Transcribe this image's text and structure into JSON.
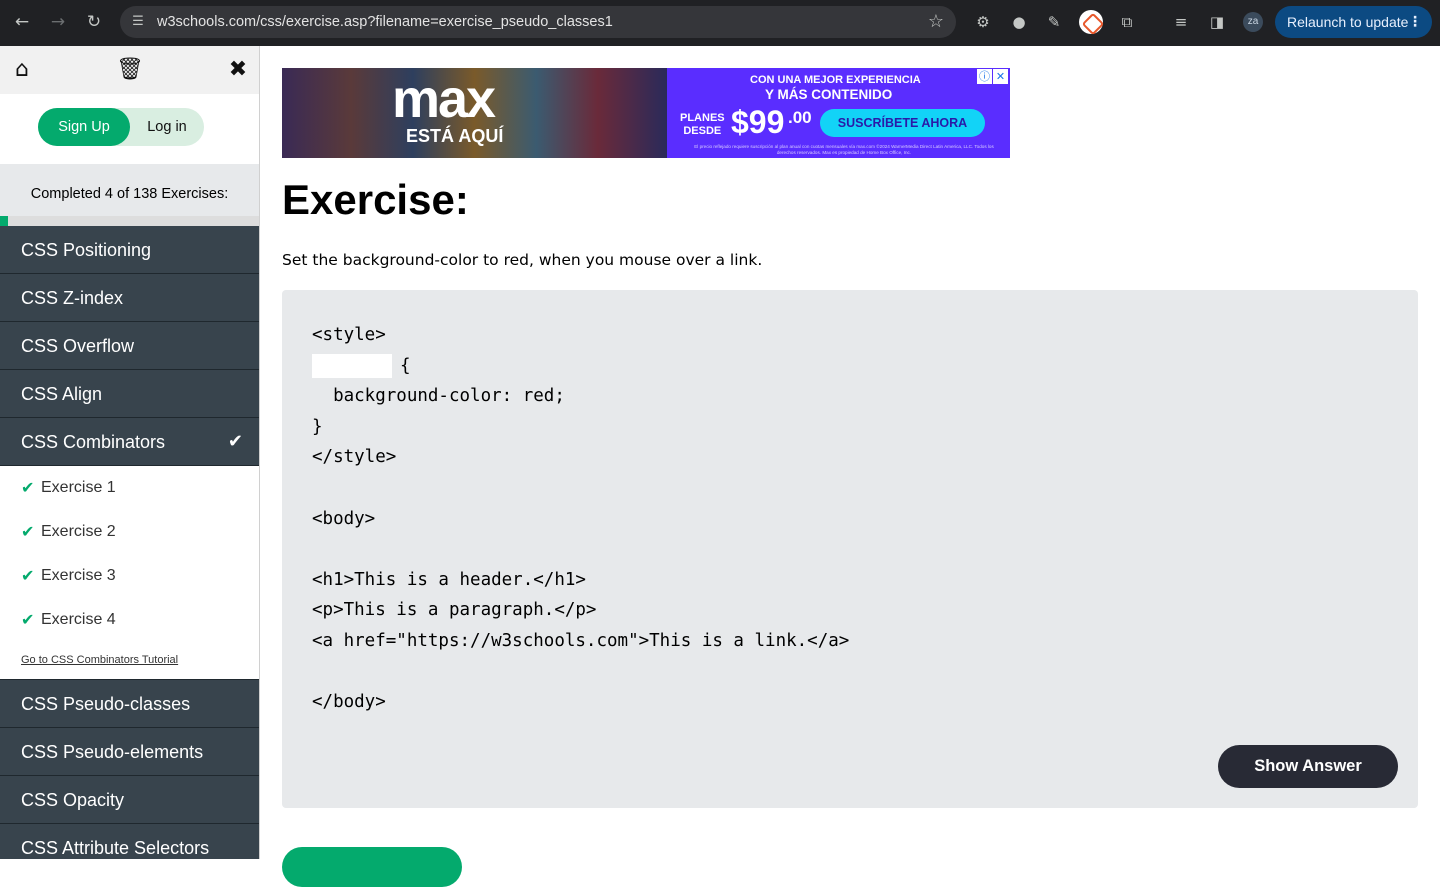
{
  "browser": {
    "url": "w3schools.com/css/exercise.asp?filename=exercise_pseudo_classes1",
    "back_icon": "arrow-left",
    "forward_icon": "arrow-right",
    "reload_icon": "reload",
    "avatar_initials": "za",
    "relaunch_label": "Relaunch to update"
  },
  "sidebar": {
    "signup_label": "Sign Up",
    "login_label": "Log in",
    "progress_text": "Completed 4 of 138 Exercises:",
    "progress_fraction": 0.029,
    "menu_before": [
      {
        "label": "CSS Positioning"
      },
      {
        "label": "CSS Z-index"
      },
      {
        "label": "CSS Overflow"
      },
      {
        "label": "CSS Align"
      }
    ],
    "open_section": {
      "label": "CSS Combinators",
      "completed": true,
      "exercises": [
        "Exercise 1",
        "Exercise 2",
        "Exercise 3",
        "Exercise 4"
      ],
      "tutorial_link": "Go to CSS Combinators Tutorial"
    },
    "menu_after": [
      {
        "label": "CSS Pseudo-classes"
      },
      {
        "label": "CSS Pseudo-elements"
      },
      {
        "label": "CSS Opacity"
      },
      {
        "label": "CSS Attribute Selectors"
      }
    ]
  },
  "ad": {
    "logo": "max",
    "tagline": "ESTÁ AQUÍ",
    "line1": "CON UNA MEJOR EXPERIENCIA",
    "line2": "Y MÁS CONTENIDO",
    "planes": "PLANES",
    "desde": "DESDE",
    "price": "$99",
    "cents": ".00",
    "cta": "SUSCRÍBETE AHORA",
    "fine_print": "El precio reflejado requiere suscripción al plan anual con cuotas mensuales vía max.com ©2024 WarnerMedia Direct Latin America, LLC. Todos los derechos reservados. Max es propiedad de Home Box Office, Inc."
  },
  "exercise": {
    "title": "Exercise:",
    "description": "Set the background-color to red, when you mouse over a link.",
    "code_lines": [
      "<style>",
      "{",
      "  background-color: red;",
      "}",
      "</style>",
      "",
      "<body>",
      "",
      "<h1>This is a header.</h1>",
      "<p>This is a paragraph.</p>",
      "<a href=\"https://w3schools.com\">This is a link.</a>",
      "",
      "</body>"
    ],
    "show_answer_label": "Show Answer"
  },
  "colors": {
    "accent_green": "#04aa6d",
    "sidebar_dark": "#38444d",
    "code_bg": "#e7e9eb",
    "button_dark": "#282a35"
  }
}
